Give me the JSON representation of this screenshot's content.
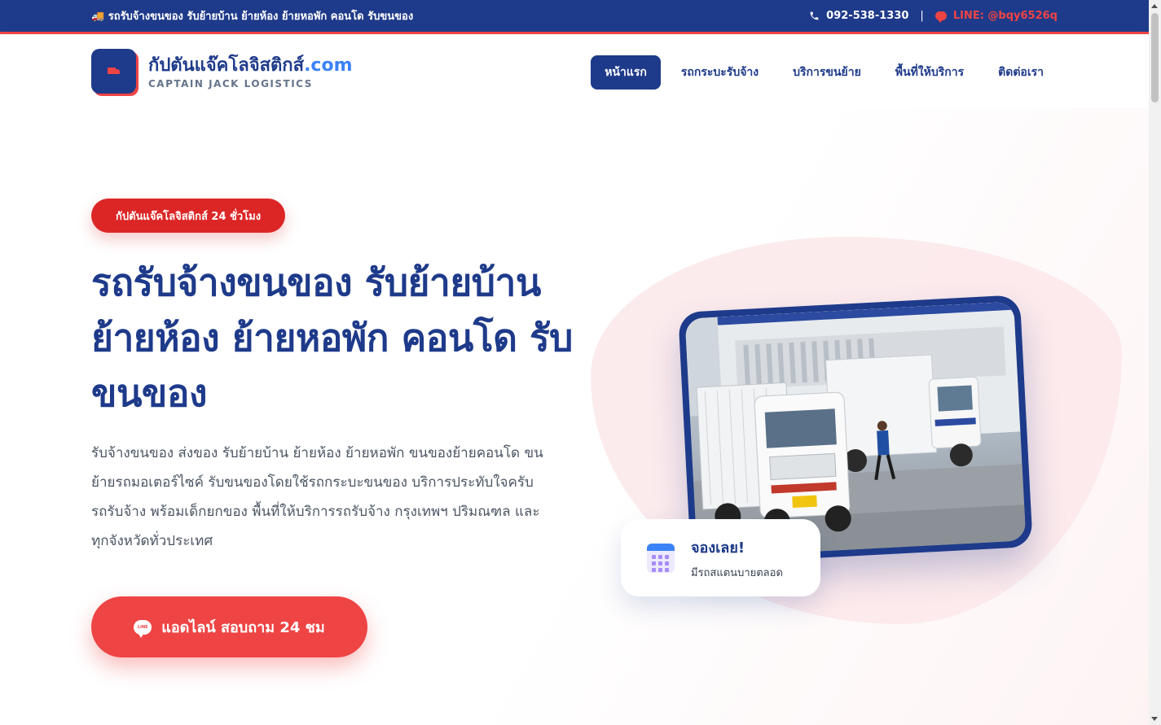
{
  "topbar": {
    "tagline_icon": "truck-emoji",
    "tagline": "🚚 รถรับจ้างขนของ รับย้ายบ้าน ย้ายห้อง ย้ายหอพัก คอนโด รับขนของ",
    "phone_icon": "phone-icon",
    "phone": "092-538-1330",
    "separator": "|",
    "line_icon": "chat-bubble-icon",
    "line": "LINE: @bqy6526q"
  },
  "nav": {
    "logo_icon": "truck-icon",
    "brand_name": "กัปตันแจ๊คโลจิสติกส์",
    "brand_domain": ".com",
    "brand_sub": "CAPTAIN JACK LOGISTICS",
    "items": [
      {
        "label": "หน้าแรก",
        "active": true
      },
      {
        "label": "รถกระบะรับจ้าง",
        "active": false
      },
      {
        "label": "บริการขนย้าย",
        "active": false
      },
      {
        "label": "พื้นที่ให้บริการ",
        "active": false
      },
      {
        "label": "ติดต่อเรา",
        "active": false
      }
    ]
  },
  "hero": {
    "badge": "กัปตันแจ๊คโลจิสติกส์ 24 ชั่วโมง",
    "headline": "รถรับจ้างขนของ รับย้ายบ้าน ย้ายห้อง ย้ายหอพัก คอนโด รับขนของ",
    "description": "รับจ้างขนของ ส่งของ รับย้ายบ้าน ย้ายห้อง ย้ายหอพัก ขนของย้ายคอนโด ขนย้ายรถมอเตอร์ไซค์ รับขนของโดยใช้รถกระบะขนของ บริการประทับใจครับ รถรับจ้าง พร้อมเด็กยกของ พื้นที่ให้บริการรถรับจ้าง กรุงเทพฯ ปริมณฑล และทุกจังหวัดทั่วประเทศ",
    "cta_icon": "line-icon",
    "cta_label": "แอดไลน์ สอบถาม 24 ชม",
    "cta_icon_text": "LINE"
  },
  "booking": {
    "icon": "calendar-icon",
    "title": "จองเลย!",
    "subtitle": "มีรถสแตนบายตลอด"
  },
  "colors": {
    "primary": "#1e3a8a",
    "accent": "#ef4444",
    "blob": "#fbe6e8"
  }
}
